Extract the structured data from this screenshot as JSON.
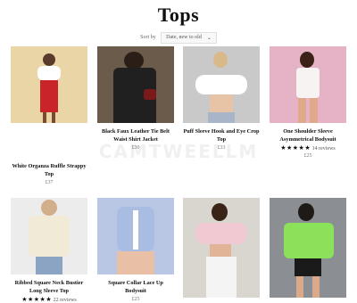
{
  "page": {
    "title": "Tops"
  },
  "sort": {
    "label": "Sort by",
    "selected": "Date, new to old"
  },
  "products": [
    {
      "name": "White Organza Ruffle Strappy Top",
      "price": "£37",
      "bg": "#e9d5a6"
    },
    {
      "name": "Black Faux Leather Tie Belt Waist Shirt Jacket",
      "price": "£30",
      "bg": "#3a3a3a"
    },
    {
      "name": "Puff Sleeve Hook and Eye Crop Top",
      "price": "£33",
      "bg": "#c9c9c9"
    },
    {
      "name": "One Shoulder Sleeve Asymmetrical Bodysuit",
      "price": "£25",
      "bg": "#e6b3c6",
      "reviews": "14 reviews"
    },
    {
      "name": "Ribbed Square Neck Bustier Long Sleeve Top",
      "price": "",
      "bg": "#ececec",
      "reviews": "22 reviews"
    },
    {
      "name": "Square Collar Lace Up Bodysuit",
      "price": "£25",
      "bg": "#b9c7e4"
    },
    {
      "name": "",
      "price": "",
      "bg": "#d9d6d0"
    },
    {
      "name": "",
      "price": "",
      "bg": "#8b8f93"
    }
  ],
  "watermark": "CAMTWEELLM",
  "stars": "★★★★★"
}
